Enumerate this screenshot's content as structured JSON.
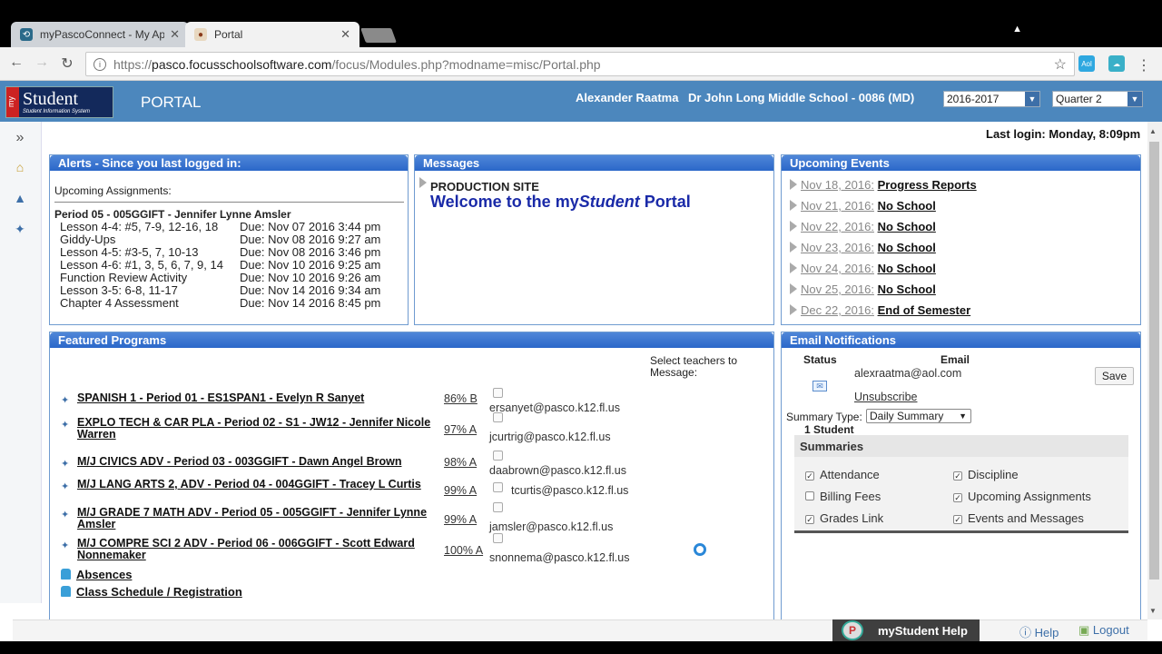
{
  "browser": {
    "tabs": [
      {
        "title": "myPascoConnect - My Ap",
        "icon": "pascoconnect-icon"
      },
      {
        "title": "Portal",
        "icon": "focus-icon"
      }
    ],
    "url_prefix": "https://",
    "url_host": "pasco.focusschoolsoftware.com",
    "url_path": "/focus/Modules.php?modname=misc/Portal.php",
    "ext1": "Aol",
    "ext2": "☁"
  },
  "header": {
    "logo_my": "my",
    "logo_text": "Student",
    "logo_sub": "Student Information System",
    "title": "PORTAL",
    "user": "Alexander Raatma",
    "school": "Dr John Long Middle School - 0086 (MD)",
    "year": "2016-2017",
    "quarter": "Quarter 2"
  },
  "last_login": "Last login: Monday, 8:09pm",
  "alerts": {
    "title": "Alerts - Since you last logged in:",
    "subtitle": "Upcoming Assignments:",
    "period": "Period 05 - 005GGIFT - Jennifer Lynne Amsler",
    "rows": [
      {
        "name": "Lesson 4-4: #5, 7-9, 12-16, 18",
        "due": "Due: Nov 07 2016 3:44 pm"
      },
      {
        "name": "Giddy-Ups",
        "due": "Due: Nov 08 2016 9:27 am"
      },
      {
        "name": "Lesson 4-5: #3-5, 7, 10-13",
        "due": "Due: Nov 08 2016 3:46 pm"
      },
      {
        "name": "Lesson 4-6: #1, 3, 5, 6, 7, 9, 14",
        "due": "Due: Nov 10 2016 9:25 am"
      },
      {
        "name": "Function Review Activity",
        "due": "Due: Nov 10 2016 9:26 am"
      },
      {
        "name": "Lesson 3-5: 6-8, 11-17",
        "due": "Due: Nov 14 2016 9:34 am"
      },
      {
        "name": "Chapter 4 Assessment",
        "due": "Due: Nov 14 2016 8:45 pm"
      }
    ]
  },
  "messages": {
    "title": "Messages",
    "production": "PRODUCTION SITE",
    "welcome_a": "Welcome to the my",
    "welcome_b": "Student",
    "welcome_c": " Portal"
  },
  "events": {
    "title": "Upcoming Events",
    "items": [
      {
        "date": "Nov 18, 2016:",
        "name": "Progress Reports"
      },
      {
        "date": "Nov 21, 2016:",
        "name": "No School"
      },
      {
        "date": "Nov 22, 2016:",
        "name": "No School"
      },
      {
        "date": "Nov 23, 2016:",
        "name": "No School"
      },
      {
        "date": "Nov 24, 2016:",
        "name": "No School"
      },
      {
        "date": "Nov 25, 2016:",
        "name": "No School"
      },
      {
        "date": "Dec 22, 2016:",
        "name": "End of Semester"
      }
    ]
  },
  "featured": {
    "title": "Featured Programs",
    "select_label": "Select teachers to Message:",
    "programs": [
      {
        "name": "SPANISH 1 - Period 01 - ES1SPAN1 - Evelyn R Sanyet",
        "grade": "86% B",
        "email": "ersanyet@pasco.k12.fl.us"
      },
      {
        "name": "EXPLO TECH & CAR PLA - Period 02 - S1 - JW12 - Jennifer Nicole Warren",
        "grade": "97% A",
        "email": "jcurtrig@pasco.k12.fl.us"
      },
      {
        "name": "M/J CIVICS ADV - Period 03 - 003GGIFT - Dawn Angel Brown",
        "grade": "98% A",
        "email": "daabrown@pasco.k12.fl.us"
      },
      {
        "name": "M/J LANG ARTS 2, ADV - Period 04 - 004GGIFT - Tracey L Curtis",
        "grade": "99% A",
        "email": "tcurtis@pasco.k12.fl.us"
      },
      {
        "name": "M/J GRADE 7 MATH ADV - Period 05 - 005GGIFT - Jennifer Lynne Amsler",
        "grade": "99% A",
        "email": "jamsler@pasco.k12.fl.us"
      },
      {
        "name": "M/J COMPRE SCI 2 ADV - Period 06 - 006GGIFT - Scott Edward Nonnemaker",
        "grade": "100% A",
        "email": "snonnema@pasco.k12.fl.us"
      }
    ],
    "absences": "Absences",
    "schedule": "Class Schedule / Registration"
  },
  "email_notifications": {
    "title": "Email Notifications",
    "status_label": "Status",
    "email_label": "Email",
    "email": "alexraatma@aol.com",
    "unsubscribe": "Unsubscribe",
    "save": "Save",
    "summary_type_label": "Summary Type:",
    "summary_type": "Daily Summary",
    "student_count": "1 Student",
    "summaries_title": "Summaries",
    "options": [
      {
        "label": "Attendance",
        "checked": true
      },
      {
        "label": "Discipline",
        "checked": true
      },
      {
        "label": "Billing Fees",
        "checked": false
      },
      {
        "label": "Upcoming Assignments",
        "checked": true
      },
      {
        "label": "Grades Link",
        "checked": true
      },
      {
        "label": "Events and Messages",
        "checked": true
      }
    ]
  },
  "footer": {
    "help_box": "myStudent Help",
    "help": "Help",
    "logout": "Logout"
  }
}
